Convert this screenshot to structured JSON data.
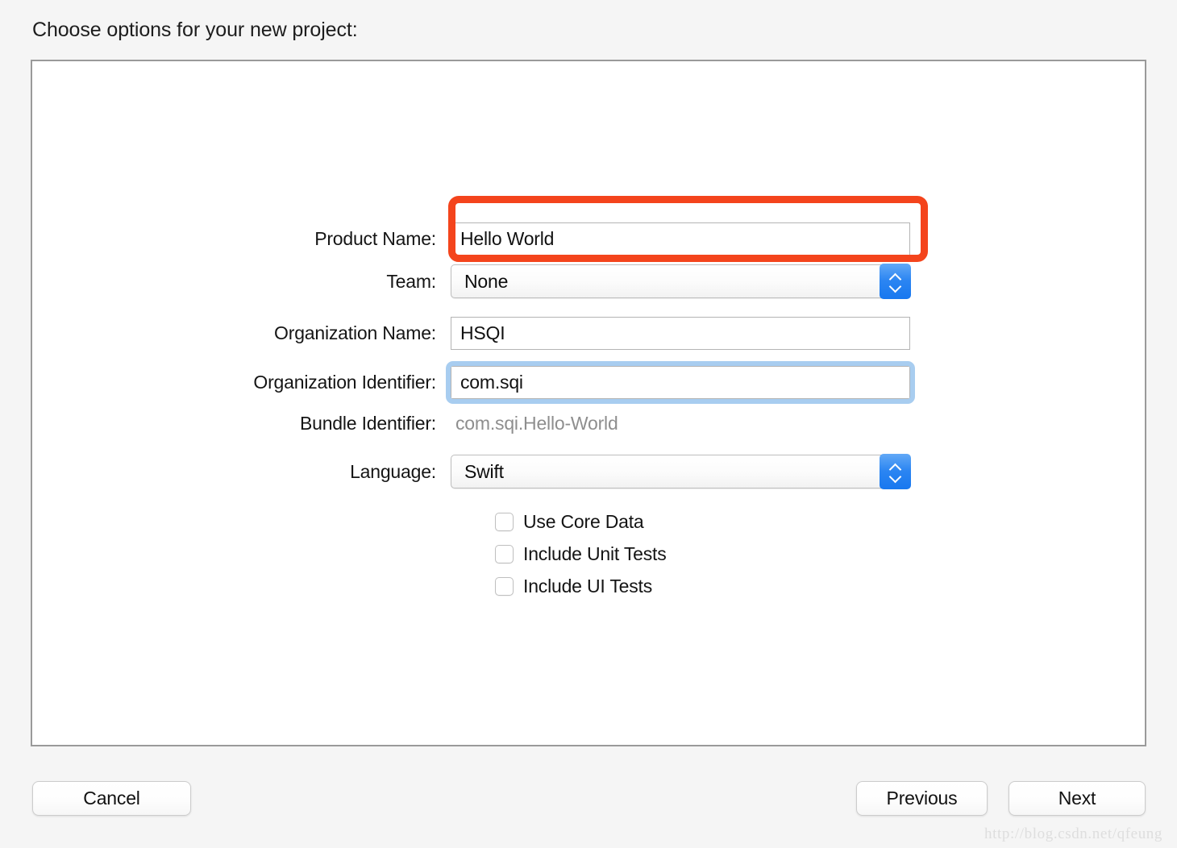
{
  "heading": "Choose options for your new project:",
  "form": {
    "rows": [
      {
        "label": "Product Name:",
        "value": "Hello World",
        "type": "text",
        "state": "highlighted"
      },
      {
        "label": "Team:",
        "value": "None",
        "type": "popup",
        "state": "normal"
      },
      {
        "label": "Organization Name:",
        "value": "HSQI",
        "type": "text",
        "state": "normal"
      },
      {
        "label": "Organization Identifier:",
        "value": "com.sqi",
        "type": "text",
        "state": "focused"
      },
      {
        "label": "Bundle Identifier:",
        "value": "com.sqi.Hello-World",
        "type": "static",
        "state": "disabled"
      },
      {
        "label": "Language:",
        "value": "Swift",
        "type": "popup",
        "state": "normal"
      }
    ],
    "checkboxes": [
      {
        "label": "Use Core Data",
        "checked": false
      },
      {
        "label": "Include Unit Tests",
        "checked": false
      },
      {
        "label": "Include UI Tests",
        "checked": false
      }
    ]
  },
  "buttons": {
    "cancel": "Cancel",
    "previous": "Previous",
    "next": "Next"
  },
  "annotation": {
    "highlight_color": "#f4441c",
    "focus_ring_color": "#a8cdf0",
    "stepper_color": "#2b85f2"
  },
  "watermark": "http://blog.csdn.net/qfeung"
}
